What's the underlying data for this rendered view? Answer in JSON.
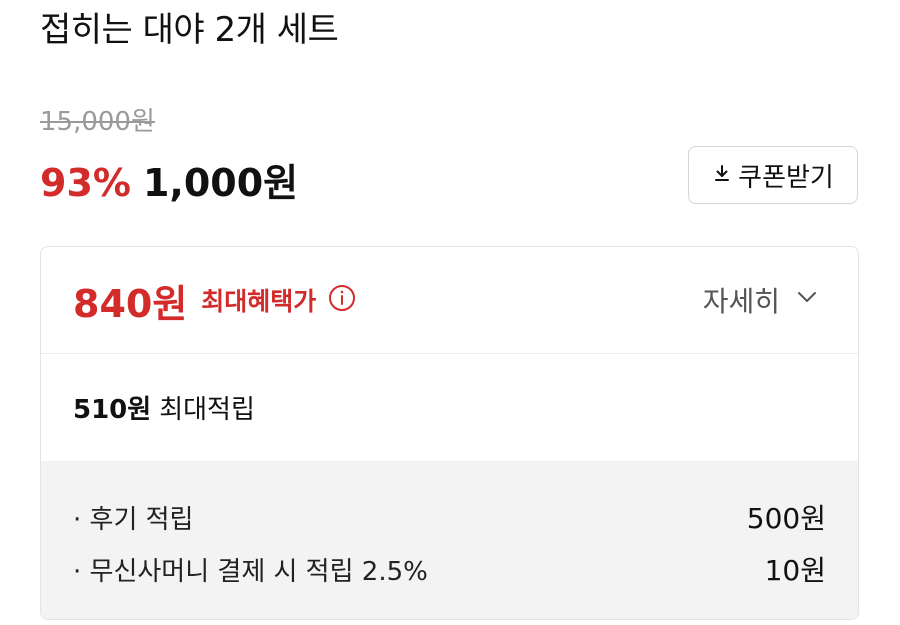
{
  "product": {
    "title": "접히는 대야 2개 세트",
    "original_price": "15,000원",
    "discount_rate": "93%",
    "sale_price": "1,000원"
  },
  "coupon": {
    "label": "쿠폰받기",
    "icon": "download-icon"
  },
  "benefit": {
    "max_price": "840원",
    "max_label": "최대혜택가",
    "info_icon": "info-icon",
    "detail_label": "자세히",
    "detail_icon": "chevron-down-icon",
    "max_points_amount": "510원",
    "max_points_label": "최대적립",
    "items": [
      {
        "label": "· 후기 적립",
        "amount": "500원"
      },
      {
        "label": "· 무신사머니 결제 시 적립 2.5%",
        "amount": "10원"
      }
    ]
  },
  "colors": {
    "accent_red": "#d32a2a",
    "muted_gray": "#9a9a9a",
    "panel_bg": "#f3f3f3"
  }
}
